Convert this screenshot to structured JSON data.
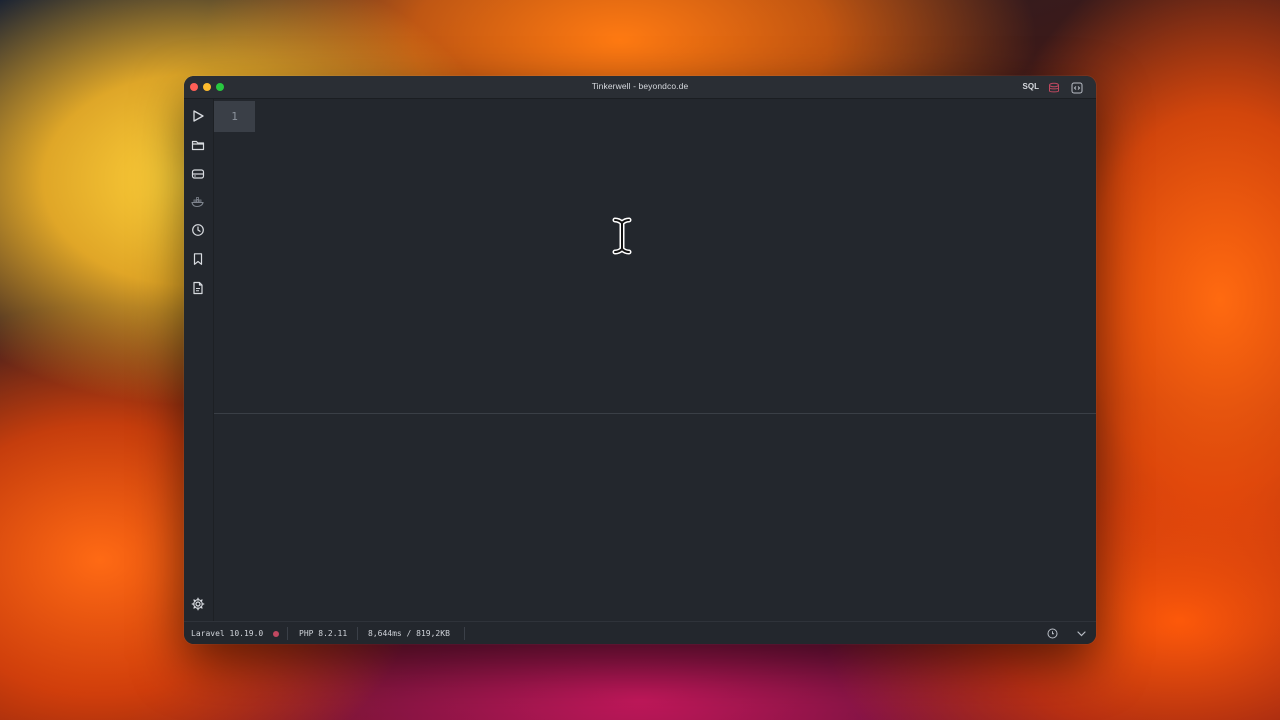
{
  "window": {
    "title": "Tinkerwell - beyondco.de",
    "sql_label": "SQL"
  },
  "sidebar": {
    "items": [
      {
        "icon": "play-icon",
        "label": "Run"
      },
      {
        "icon": "folder-icon",
        "label": "Open"
      },
      {
        "icon": "database-icon",
        "label": "Database"
      },
      {
        "icon": "docker-icon",
        "label": "Docker"
      },
      {
        "icon": "clock-icon",
        "label": "History"
      },
      {
        "icon": "bookmark-icon",
        "label": "Snippets"
      },
      {
        "icon": "document-icon",
        "label": "Documentation"
      }
    ],
    "settings_icon": "gear-icon"
  },
  "editor": {
    "line_numbers": [
      "1"
    ]
  },
  "status": {
    "framework": "Laravel 10.19.0",
    "php": "PHP 8.2.11",
    "metrics": "8,644ms / 819,2KB"
  },
  "colors": {
    "background": "#23272d",
    "accent_red": "#c04860",
    "text": "#cfd3d9"
  }
}
